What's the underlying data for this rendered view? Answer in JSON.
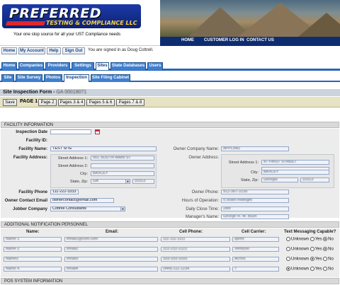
{
  "header": {
    "logo_line1": "PREFERRED",
    "logo_line2": "TESTING & COMPLIANCE LLC",
    "tagline": "Your one stop source for all your UST Compliance needs",
    "topnav": [
      "HOME",
      "CUSTOMER LOG IN",
      "CONTACT US"
    ]
  },
  "account": {
    "buttons": [
      "Home",
      "My Account",
      "Help",
      "Sign Out"
    ],
    "signed_in": "You are signed in as Doug Cottrell."
  },
  "nav_tabs": [
    "Home",
    "Companies",
    "Providers",
    "Settings",
    "Sites",
    "State Databases",
    "Users"
  ],
  "nav_active": "Sites",
  "sub_tabs": [
    "Site",
    "Site Survey",
    "Photos",
    "Inspection",
    "Site Filing Cabinet"
  ],
  "sub_active": "Inspection",
  "form": {
    "title": "Site Inspection Form - ",
    "title_suffix": "GA 00018071",
    "save": "Save",
    "page_label": "PAGE 1",
    "page_buttons": [
      "Page 2",
      "Pages 3 & 4",
      "Pages 5 & 6",
      "Pages 7 & 8"
    ]
  },
  "facility": {
    "section": "FACILITY INFORMATION",
    "inspection_date_label": "Inspection Date",
    "facility_id_label": "Facility ID:",
    "facility_name_label": "Facility Name:",
    "facility_name": "TEST SITE",
    "facility_address_label": "Facility Address:",
    "street1_label": "Street Address 1:",
    "street1": "901 SOUTH MAIN ST",
    "street2_label": "Street Address 2:",
    "city_label": "City:",
    "city": "BAXLEY",
    "statezip_label": "State, Zip:",
    "state": "GA",
    "zip": "31513",
    "owner_company_label": "Owner Company Name:",
    "owner_company": "APPLING",
    "owner_address_label": "Owner Address:",
    "owner_street1_label": "Street Address 1:",
    "owner_street1": "47 FIRST STREET",
    "owner_city_label": "City:",
    "owner_city": "BAXLEY",
    "owner_statezip_label": "State, Zip:",
    "owner_state": "Georgia",
    "owner_zip": "31513",
    "facility_phone_label": "Facility Phone",
    "facility_phone": "111-222-3333",
    "owner_email_label": "Owner Contact Email",
    "owner_email": "ownercontact@email.com",
    "jobber_label": "Jobber Company",
    "jobber": "Cottrell Consultants",
    "owner_phone_label": "Owner Phone:",
    "owner_phone": "912-367-3135",
    "hours_label": "Hours of Operation:",
    "hours": "5:30am-midnight",
    "daily_close_label": "Daily Close Time:",
    "daily_close": "24hr",
    "manager_label": "Manager's Name:",
    "manager": "George H. W. Bush"
  },
  "notification": {
    "section": "ADDITIONAL NOTIFICATION PERSONNEL",
    "headers": [
      "Name:",
      "Email:",
      "Cell Phone:",
      "Cell Carrier:",
      "Text Messaging Capable?"
    ],
    "rows": [
      {
        "name": "Name 1",
        "email": "email1@com.com",
        "phone": "111-111-1111",
        "carrier": "sprint",
        "sel": "no"
      },
      {
        "name": "Name 2",
        "email": "email2",
        "phone": "222-222-2222",
        "carrier": "Verifizon",
        "sel": "no"
      },
      {
        "name": "Name3",
        "email": "email3",
        "phone": "333-333-3333",
        "carrier": "Acrms",
        "sel": "yes"
      },
      {
        "name": "Name 4",
        "email": "email4",
        "phone": "(444)-111-1234",
        "carrier": "T",
        "sel": "unknown"
      }
    ],
    "radio_labels": [
      "Unknown",
      "Yes",
      "No"
    ]
  },
  "pos": {
    "section": "POS SYSTEM INFORMATION"
  }
}
